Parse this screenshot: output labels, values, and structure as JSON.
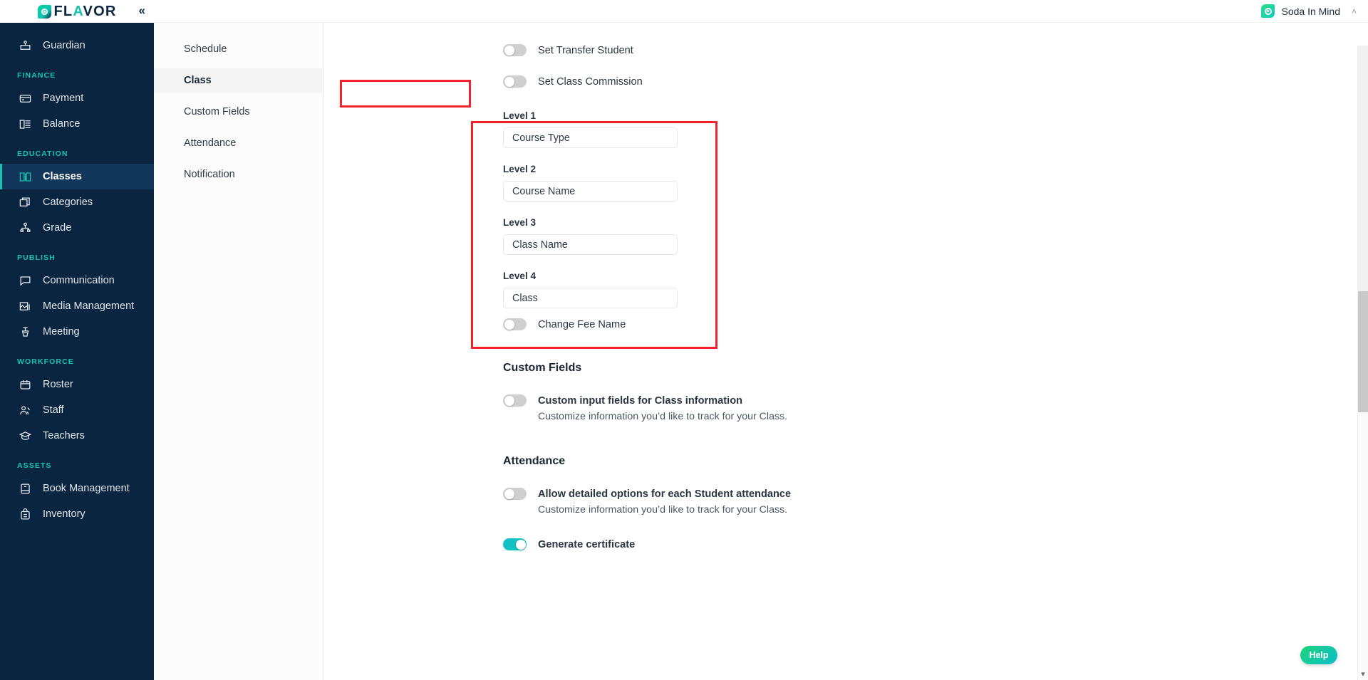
{
  "brand": {
    "name_plain": "FL",
    "name_accent": "A",
    "name_tail": "VOR",
    "full": "FLAVOR",
    "collapse_icon": "«"
  },
  "topbar": {
    "account_name": "Soda In Mind",
    "chevron": "˄",
    "logo_icon": "soda-in-mind-logo"
  },
  "sidebar": {
    "items": [
      {
        "type": "item",
        "label": "Guardian",
        "icon": "guardian-icon",
        "active": false
      },
      {
        "type": "group",
        "label": "FINANCE"
      },
      {
        "type": "item",
        "label": "Payment",
        "icon": "payment-card-icon",
        "active": false
      },
      {
        "type": "item",
        "label": "Balance",
        "icon": "balance-icon",
        "active": false
      },
      {
        "type": "group",
        "label": "EDUCATION"
      },
      {
        "type": "item",
        "label": "Classes",
        "icon": "book-open-icon",
        "active": true
      },
      {
        "type": "item",
        "label": "Categories",
        "icon": "categories-icon",
        "active": false
      },
      {
        "type": "item",
        "label": "Grade",
        "icon": "grade-hierarchy-icon",
        "active": false
      },
      {
        "type": "group",
        "label": "PUBLISH"
      },
      {
        "type": "item",
        "label": "Communication",
        "icon": "chat-bubble-icon",
        "active": false
      },
      {
        "type": "item",
        "label": "Media Management",
        "icon": "media-image-icon",
        "active": false
      },
      {
        "type": "item",
        "label": "Meeting",
        "icon": "podium-icon",
        "active": false
      },
      {
        "type": "group",
        "label": "WORKFORCE"
      },
      {
        "type": "item",
        "label": "Roster",
        "icon": "calendar-icon",
        "active": false
      },
      {
        "type": "item",
        "label": "Staff",
        "icon": "people-icon",
        "active": false
      },
      {
        "type": "item",
        "label": "Teachers",
        "icon": "graduation-cap-icon",
        "active": false
      },
      {
        "type": "group",
        "label": "ASSETS"
      },
      {
        "type": "item",
        "label": "Book Management",
        "icon": "book-icon",
        "active": false
      },
      {
        "type": "item",
        "label": "Inventory",
        "icon": "inventory-bag-icon",
        "active": false
      }
    ]
  },
  "subnav": {
    "items": [
      {
        "label": "Schedule",
        "active": false
      },
      {
        "label": "Class",
        "active": true
      },
      {
        "label": "Custom Fields",
        "active": false
      },
      {
        "label": "Attendance",
        "active": false
      },
      {
        "label": "Notification",
        "active": false
      }
    ]
  },
  "main": {
    "toggles_top": [
      {
        "label": "Set Transfer Student",
        "on": false
      },
      {
        "label": "Set Class Commission",
        "on": false
      }
    ],
    "levels": [
      {
        "label": "Level 1",
        "value": "Course Type"
      },
      {
        "label": "Level 2",
        "value": "Course Name"
      },
      {
        "label": "Level 3",
        "value": "Class Name"
      },
      {
        "label": "Level 4",
        "value": "Class"
      }
    ],
    "change_fee": {
      "label": "Change Fee Name",
      "on": false
    },
    "custom_fields": {
      "title": "Custom Fields",
      "toggle_label": "Custom input fields for Class information",
      "description": "Customize information you’d like to track for your Class.",
      "on": false
    },
    "attendance": {
      "title": "Attendance",
      "toggle_label": "Allow detailed options for each Student attendance",
      "description": "Customize information you’d like to track for your Class.",
      "on": false,
      "certificate_label": "Generate certificate",
      "certificate_on": true
    }
  },
  "help": {
    "label": "Help"
  },
  "colors": {
    "sidebar_bg": "#0a2540",
    "accent_teal": "#17c3b2",
    "toggle_on": "#13c2c2",
    "annotation_red": "#f5222d"
  }
}
